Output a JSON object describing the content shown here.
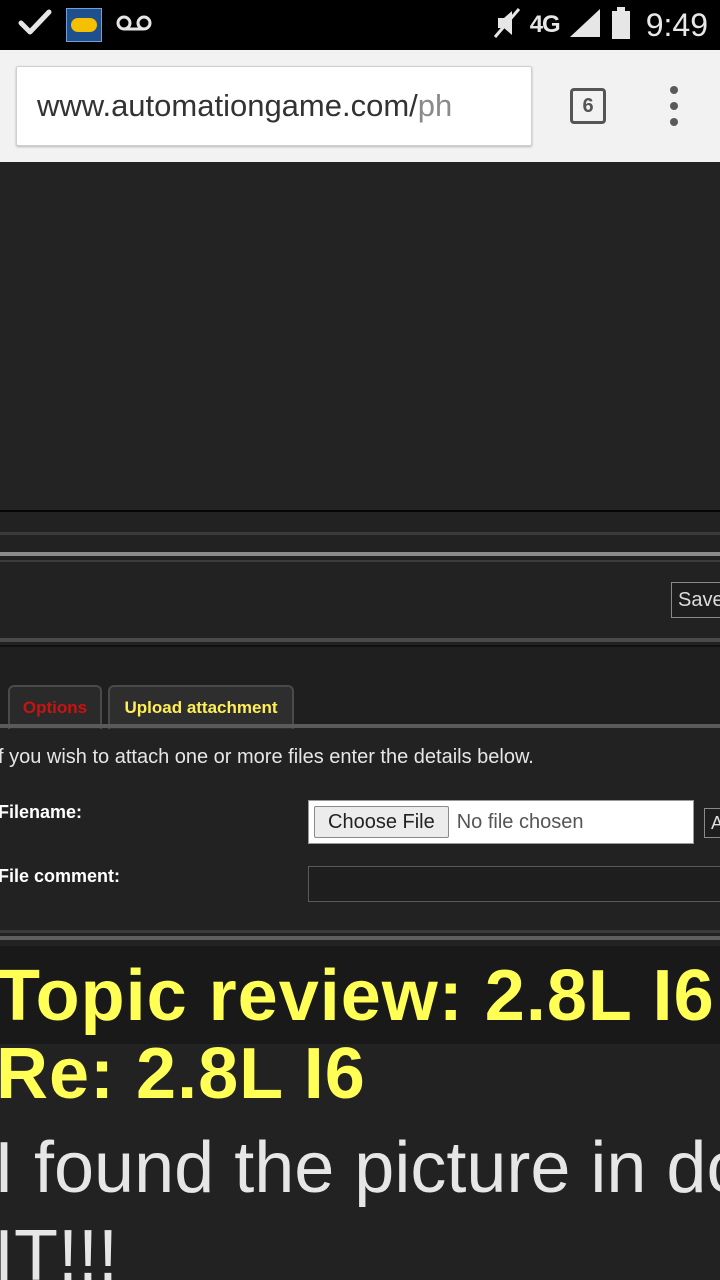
{
  "status_bar": {
    "time": "9:49",
    "network": "4G",
    "icons": [
      "check-icon",
      "app-icon",
      "voicemail-icon",
      "mute-icon",
      "signal-icon",
      "battery-icon"
    ]
  },
  "browser": {
    "url_domain": "www.automationgame.com/",
    "url_path": "ph",
    "tab_count": "6"
  },
  "editor": {
    "save_label": "Save"
  },
  "tabs": [
    {
      "label": "Options",
      "color": "#cc1111"
    },
    {
      "label": "Upload attachment",
      "color": "#ffee55"
    }
  ],
  "attachment": {
    "intro": "f you wish to attach one or more files enter the details below.",
    "filename_label": "Filename:",
    "choose_file_label": "Choose File",
    "no_file_text": "No file chosen",
    "add_label": "A",
    "comment_label": "File comment:"
  },
  "topic": {
    "title": "Topic review: 2.8L I6",
    "post_subject": "Re: 2.8L I6",
    "post_body_line1": "I found the picture in do",
    "post_body_line2": "IT!!!"
  },
  "colors": {
    "accent_yellow": "#ffff55",
    "tab_red": "#cc1111",
    "page_bg": "#222222"
  }
}
